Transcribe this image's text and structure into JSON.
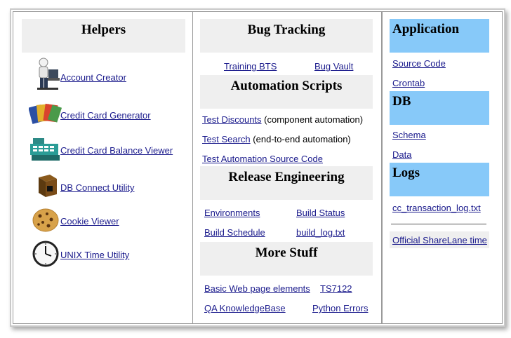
{
  "helpers": {
    "title": "Helpers",
    "items": [
      {
        "label": "Account Creator",
        "icon": "person-at-computer-icon"
      },
      {
        "label": "Credit Card Generator",
        "icon": "credit-cards-icon"
      },
      {
        "label": "Credit Card Balance Viewer",
        "icon": "cash-register-icon"
      },
      {
        "label": "DB Connect Utility",
        "icon": "db-box-icon"
      },
      {
        "label": "Cookie Viewer",
        "icon": "cookie-icon"
      },
      {
        "label": "UNIX Time Utility",
        "icon": "clock-icon"
      }
    ]
  },
  "bug_tracking": {
    "title": "Bug Tracking",
    "links": [
      "Training BTS",
      "Bug Vault"
    ]
  },
  "automation": {
    "title": "Automation Scripts",
    "items": [
      {
        "link": "Test Discounts",
        "note": "(component automation)"
      },
      {
        "link": "Test Search",
        "note": "(end-to-end automation)"
      },
      {
        "link": "Test Automation Source Code",
        "note": ""
      }
    ]
  },
  "release": {
    "title": "Release Engineering",
    "links": [
      "Environments",
      "Build Status",
      "Build Schedule",
      "build_log.txt"
    ]
  },
  "more": {
    "title": "More Stuff",
    "links": [
      "Basic Web page elements",
      "TS7122",
      "QA KnowledgeBase",
      "Python Errors"
    ]
  },
  "application": {
    "title": "Application",
    "links": [
      "Source Code",
      "Crontab"
    ]
  },
  "db": {
    "title": "DB",
    "links": [
      "Schema",
      "Data"
    ]
  },
  "logs": {
    "title": "Logs",
    "links": [
      "cc_transaction_log.txt"
    ],
    "time_link": "Official ShareLane time"
  },
  "colors": {
    "header_gray": "#efefef",
    "header_blue": "#87c9f9",
    "link": "#1a1a8c"
  }
}
